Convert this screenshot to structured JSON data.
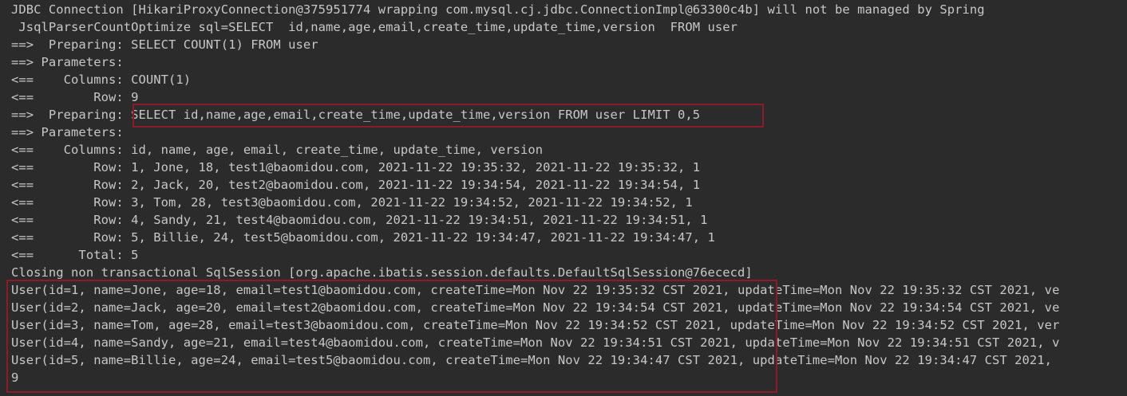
{
  "console": {
    "lines": [
      "JDBC Connection [HikariProxyConnection@375951774 wrapping com.mysql.cj.jdbc.ConnectionImpl@63300c4b] will not be managed by Spring",
      " JsqlParserCountOptimize sql=SELECT  id,name,age,email,create_time,update_time,version  FROM user",
      "==>  Preparing: SELECT COUNT(1) FROM user",
      "==> Parameters: ",
      "<==    Columns: COUNT(1)",
      "<==        Row: 9",
      "==>  Preparing: SELECT id,name,age,email,create_time,update_time,version FROM user LIMIT 0,5",
      "==> Parameters: ",
      "<==    Columns: id, name, age, email, create_time, update_time, version",
      "<==        Row: 1, Jone, 18, test1@baomidou.com, 2021-11-22 19:35:32, 2021-11-22 19:35:32, 1",
      "<==        Row: 2, Jack, 20, test2@baomidou.com, 2021-11-22 19:34:54, 2021-11-22 19:34:54, 1",
      "<==        Row: 3, Tom, 28, test3@baomidou.com, 2021-11-22 19:34:52, 2021-11-22 19:34:52, 1",
      "<==        Row: 4, Sandy, 21, test4@baomidou.com, 2021-11-22 19:34:51, 2021-11-22 19:34:51, 1",
      "<==        Row: 5, Billie, 24, test5@baomidou.com, 2021-11-22 19:34:47, 2021-11-22 19:34:47, 1",
      "<==      Total: 5",
      "Closing non transactional SqlSession [org.apache.ibatis.session.defaults.DefaultSqlSession@76ececd]",
      "User(id=1, name=Jone, age=18, email=test1@baomidou.com, createTime=Mon Nov 22 19:35:32 CST 2021, updateTime=Mon Nov 22 19:35:32 CST 2021, ve",
      "User(id=2, name=Jack, age=20, email=test2@baomidou.com, createTime=Mon Nov 22 19:34:54 CST 2021, updateTime=Mon Nov 22 19:34:54 CST 2021, ve",
      "User(id=3, name=Tom, age=28, email=test3@baomidou.com, createTime=Mon Nov 22 19:34:52 CST 2021, updateTime=Mon Nov 22 19:34:52 CST 2021, ver",
      "User(id=4, name=Sandy, age=21, email=test4@baomidou.com, createTime=Mon Nov 22 19:34:51 CST 2021, updateTime=Mon Nov 22 19:34:51 CST 2021, v",
      "User(id=5, name=Billie, age=24, email=test5@baomidou.com, createTime=Mon Nov 22 19:34:47 CST 2021, updateTime=Mon Nov 22 19:34:47 CST 2021,",
      "9"
    ]
  },
  "colors": {
    "background": "#2b2b2b",
    "text": "#c7c7c7",
    "highlight_border": "#8b1a2b"
  }
}
